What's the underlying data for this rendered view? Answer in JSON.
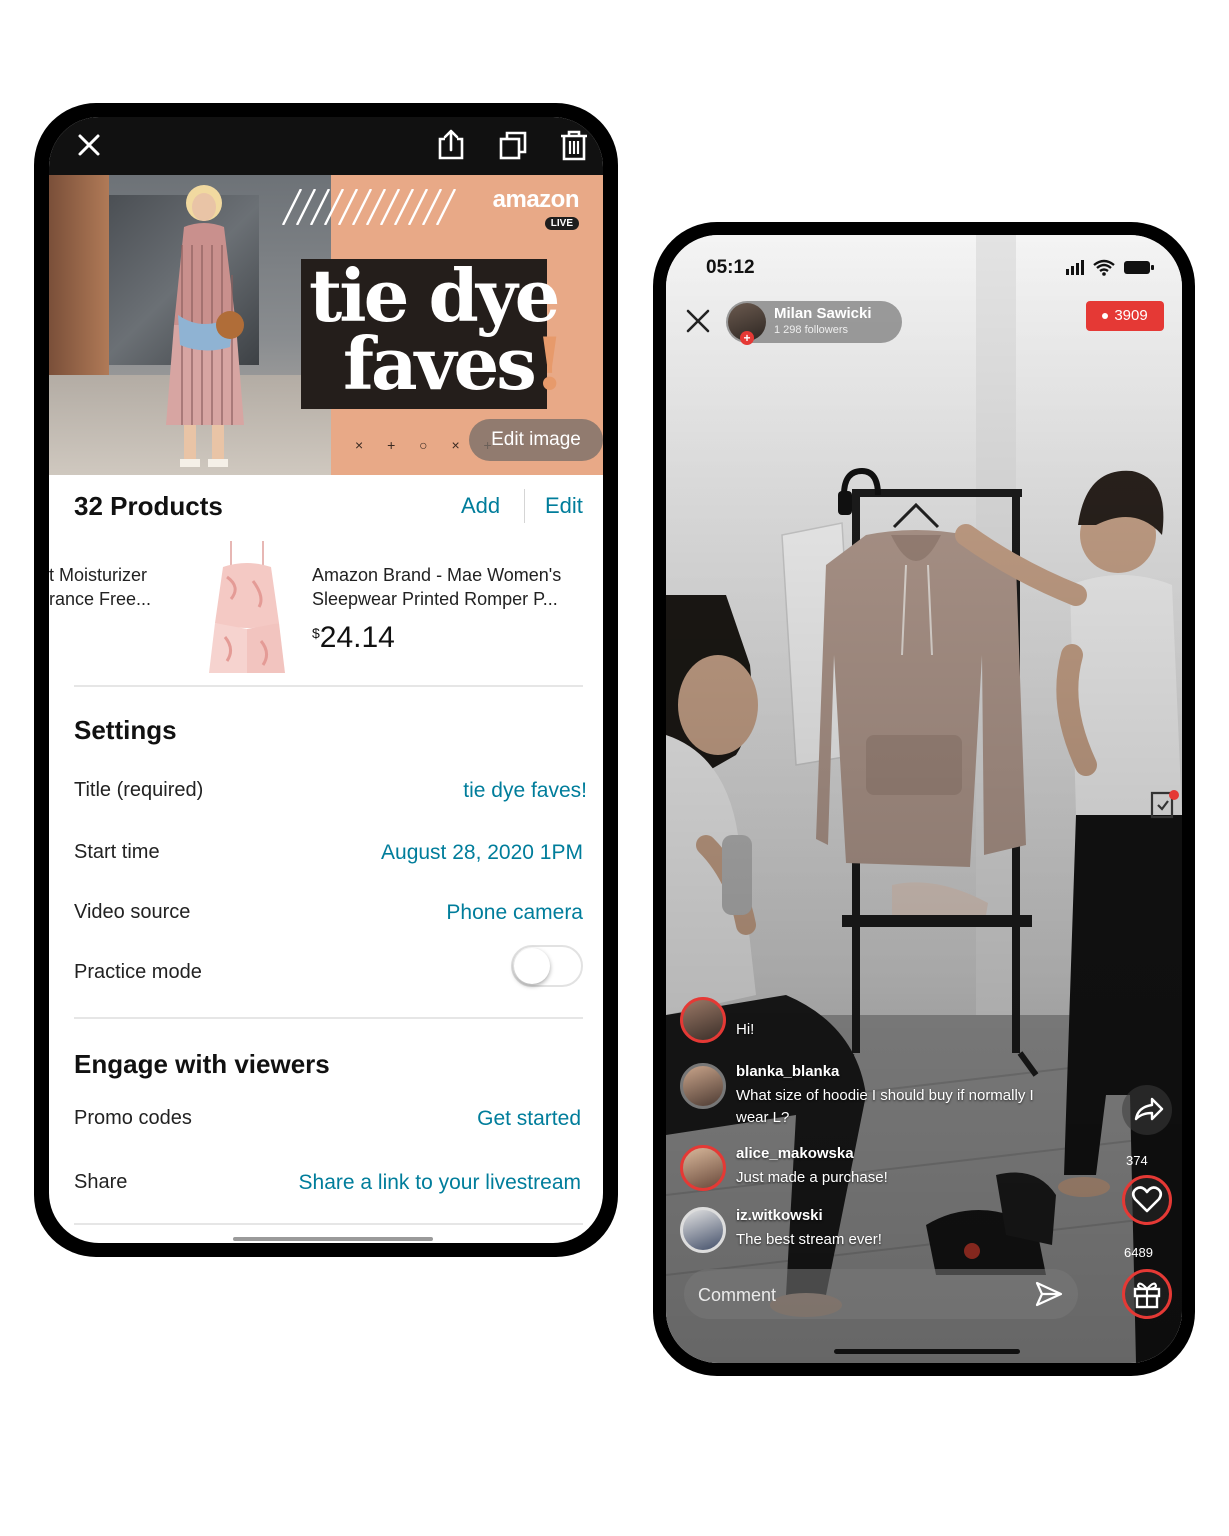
{
  "left_phone": {
    "toolbar": {
      "close_icon": "close-icon",
      "share_icon": "share-upload-icon",
      "duplicate_icon": "duplicate-icon",
      "delete_icon": "trash-icon"
    },
    "hero": {
      "brand": "amazon",
      "brand_badge": "LIVE",
      "title_line1": "tie dye",
      "title_line2": "faves",
      "title_bang": "!",
      "dots": "× + ○ × +",
      "edit_image_label": "Edit image"
    },
    "products": {
      "title": "32 Products",
      "add_label": "Add",
      "edit_label": "Edit",
      "items": [
        {
          "name": "t Moisturizer\nrance Free..."
        },
        {
          "name": "Amazon Brand - Mae Women's Sleepwear Printed Romper P...",
          "price_symbol": "$",
          "price": "24.14"
        }
      ]
    },
    "settings": {
      "title": "Settings",
      "rows": [
        {
          "label": "Title (required)",
          "value": "tie dye faves!"
        },
        {
          "label": "Start time",
          "value": "August 28, 2020 1PM"
        },
        {
          "label": "Video source",
          "value": "Phone camera"
        },
        {
          "label": "Practice mode",
          "toggle_on": false
        }
      ]
    },
    "engage": {
      "title": "Engage with viewers",
      "rows": [
        {
          "label": "Promo codes",
          "value": "Get started"
        },
        {
          "label": "Share",
          "value": "Share a link to your livestream"
        }
      ]
    }
  },
  "right_phone": {
    "status": {
      "time": "05:12"
    },
    "host": {
      "name": "Milan Sawicki",
      "followers": "1 298 followers"
    },
    "viewers": "3909",
    "chat": [
      {
        "user": "",
        "message": "Hi!"
      },
      {
        "user": "blanka_blanka",
        "message": "What size of hoodie I should buy if normally I wear L?"
      },
      {
        "user": "alice_makowska",
        "message": "Just made a purchase!"
      },
      {
        "user": "iz.witkowski",
        "message": "The best stream ever!"
      }
    ],
    "likes": "374",
    "gifts": "6489",
    "comment_placeholder": "Comment",
    "colors": {
      "accent": "#e53935"
    }
  },
  "colors": {
    "link": "#007d9b",
    "hero_bg": "#e8a987",
    "title_box": "#241e1b"
  }
}
